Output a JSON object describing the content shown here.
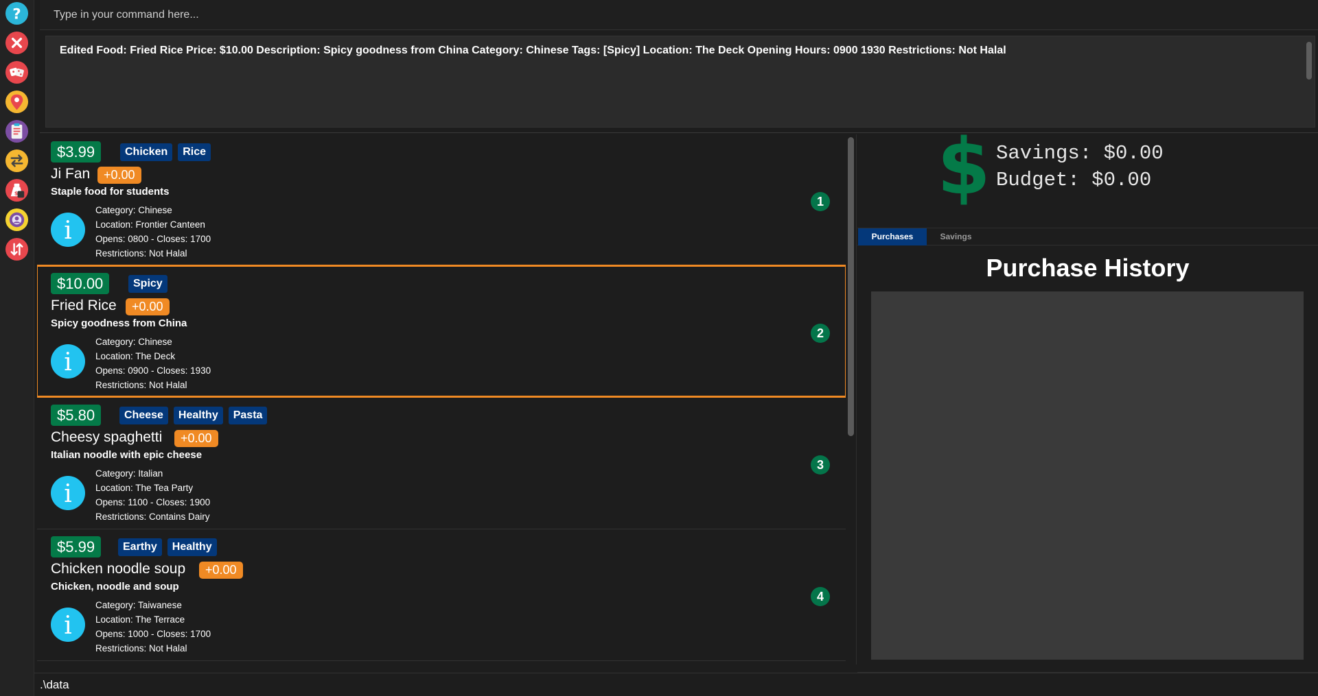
{
  "sidebar": {
    "icons": [
      {
        "name": "help-icon",
        "color": "#2bb6d9"
      },
      {
        "name": "exit-icon",
        "color": "#e8474d"
      },
      {
        "name": "dice-icon",
        "color": "#e8474d"
      },
      {
        "name": "location-pin-icon",
        "color": "#f5b731"
      },
      {
        "name": "clipboard-icon",
        "color": "#7c4ea3"
      },
      {
        "name": "swap-arrows-icon",
        "color": "#f5b731"
      },
      {
        "name": "money-bag-icon",
        "color": "#e8474d"
      },
      {
        "name": "coin-icon",
        "color": "#f5d331"
      },
      {
        "name": "sort-icon",
        "color": "#e8474d"
      }
    ]
  },
  "command": {
    "placeholder": "Type in your command here..."
  },
  "result": {
    "text": "Edited Food: Fried Rice Price: $10.00 Description: Spicy goodness from China Category: Chinese Tags: [Spicy] Location: The Deck Opening Hours: 0900 1930 Restrictions: Not Halal"
  },
  "foods": [
    {
      "index": "1",
      "price": "$3.99",
      "tags": [
        "Chicken",
        "Rice"
      ],
      "name": "Ji Fan",
      "delta": "+0.00",
      "description": "Staple food for students",
      "category": "Category: Chinese",
      "location": "Location: Frontier Canteen",
      "hours": "Opens: 0800 - Closes: 1700",
      "restrictions": "Restrictions: Not Halal",
      "selected": false
    },
    {
      "index": "2",
      "price": "$10.00",
      "tags": [
        "Spicy"
      ],
      "name": "Fried Rice",
      "delta": "+0.00",
      "description": "Spicy goodness from China",
      "category": "Category: Chinese",
      "location": "Location: The Deck",
      "hours": "Opens: 0900 - Closes: 1930",
      "restrictions": "Restrictions: Not Halal",
      "selected": true
    },
    {
      "index": "3",
      "price": "$5.80",
      "tags": [
        "Cheese",
        "Healthy",
        "Pasta"
      ],
      "name": "Cheesy spaghetti",
      "delta": "+0.00",
      "description": "Italian noodle with epic cheese",
      "category": "Category: Italian",
      "location": "Location: The Tea Party",
      "hours": "Opens: 1100 - Closes: 1900",
      "restrictions": "Restrictions: Contains Dairy",
      "selected": false
    },
    {
      "index": "4",
      "price": "$5.99",
      "tags": [
        "Earthy",
        "Healthy"
      ],
      "name": "Chicken noodle soup",
      "delta": "+0.00",
      "description": "Chicken, noodle and soup",
      "category": "Category: Taiwanese",
      "location": "Location: The Terrace",
      "hours": "Opens: 1000 - Closes: 1700",
      "restrictions": "Restrictions: Not Halal",
      "selected": false
    }
  ],
  "wallet": {
    "savings": "Savings: $0.00",
    "budget": "Budget: $0.00"
  },
  "tabs": {
    "purchases": "Purchases",
    "savings": "Savings"
  },
  "purchase_history": {
    "title": "Purchase History"
  },
  "status": {
    "path": ".\\data"
  },
  "colors": {
    "price_green": "#047a48",
    "tag_blue": "#04387a",
    "delta_orange": "#f08a24",
    "selection_orange": "#f08a24",
    "info_cyan": "#22c3f0"
  }
}
